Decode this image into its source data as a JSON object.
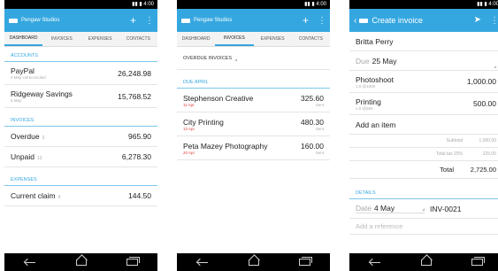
{
  "status_time": "4:00",
  "phone1": {
    "title": "Pengaw Studios",
    "tabs": [
      "DASHBOARD",
      "INVOICES",
      "EXPENSES",
      "CONTACTS"
    ],
    "accounts_header": "ACCOUNTS",
    "accounts": [
      {
        "name": "PayPal",
        "sub": "4 May Unreconciled",
        "value": "26,248.98"
      },
      {
        "name": "Ridgeway Savings",
        "sub": "6 May",
        "value": "15,768.52"
      }
    ],
    "invoices_header": "INVOICES",
    "invoices": [
      {
        "name": "Overdue",
        "count": "3",
        "value": "965.90"
      },
      {
        "name": "Unpaid",
        "count": "12",
        "value": "6,278.30"
      }
    ],
    "expenses_header": "EXPENSES",
    "expenses": [
      {
        "name": "Current claim",
        "count": "4",
        "value": "144.50"
      }
    ]
  },
  "phone2": {
    "title": "Pengaw Studios",
    "tabs": [
      "DASHBOARD",
      "INVOICES",
      "EXPENSES",
      "CONTACTS"
    ],
    "overdue_label": "OVERDUE INVOICES",
    "due_header": "DUE APRIL",
    "items": [
      {
        "name": "Stephenson Creative",
        "date": "11 Apr",
        "value": "325.60",
        "status": "Sent"
      },
      {
        "name": "City Printing",
        "date": "13 Apr",
        "value": "480.30",
        "status": "Sent"
      },
      {
        "name": "Peta Mazey Photography",
        "date": "20 Apr",
        "value": "160.00",
        "status": "Sent"
      }
    ]
  },
  "phone3": {
    "title": "Create invoice",
    "contact": "Britta Perry",
    "due_label": "Due",
    "due_value": "25 May",
    "lines": [
      {
        "name": "Photoshoot",
        "sub": "1.0 @1000",
        "value": "1,000.00"
      },
      {
        "name": "Printing",
        "sub": "1.0 @500",
        "value": "500.00"
      }
    ],
    "add_item": "Add an item",
    "subtotal_label": "Subtotal",
    "subtotal_value": "1,500.00",
    "tax_label": "Total tax 15%",
    "tax_value": "225.00",
    "total_label": "Total",
    "total_value": "2,725.00",
    "details_header": "DETAILS",
    "date_label": "Date",
    "date_value": "4 May",
    "invoice_number": "INV-0021",
    "reference_placeholder": "Add a reference"
  }
}
